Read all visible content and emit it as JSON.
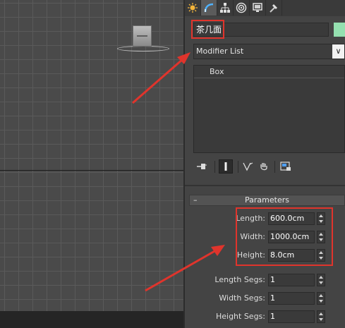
{
  "command_panel": {
    "tabs": [
      {
        "name": "create",
        "icon": "sun-icon"
      },
      {
        "name": "modify",
        "icon": "modify-arc-icon"
      },
      {
        "name": "hierarchy",
        "icon": "hierarchy-icon"
      },
      {
        "name": "motion",
        "icon": "motion-circle-icon"
      },
      {
        "name": "display",
        "icon": "monitor-icon"
      },
      {
        "name": "utilities",
        "icon": "hammer-icon"
      }
    ],
    "active_tab": "modify",
    "object_name": "茶几面",
    "object_color": "#95e0b0",
    "modifier_list": {
      "label": "Modifier List",
      "arrow": "∨"
    },
    "stack": [
      {
        "label": "Box"
      }
    ]
  },
  "parameters": {
    "header": "Parameters",
    "collapse": "–",
    "fields": [
      {
        "label": "Length:",
        "value": "600.0cm"
      },
      {
        "label": "Width:",
        "value": "1000.0cm"
      },
      {
        "label": "Height:",
        "value": "8.0cm"
      },
      {
        "label": "Length Segs:",
        "value": "1"
      },
      {
        "label": "Width Segs:",
        "value": "1"
      },
      {
        "label": "Height Segs:",
        "value": "1"
      }
    ]
  },
  "annotations": {
    "color": "#e0342c"
  }
}
